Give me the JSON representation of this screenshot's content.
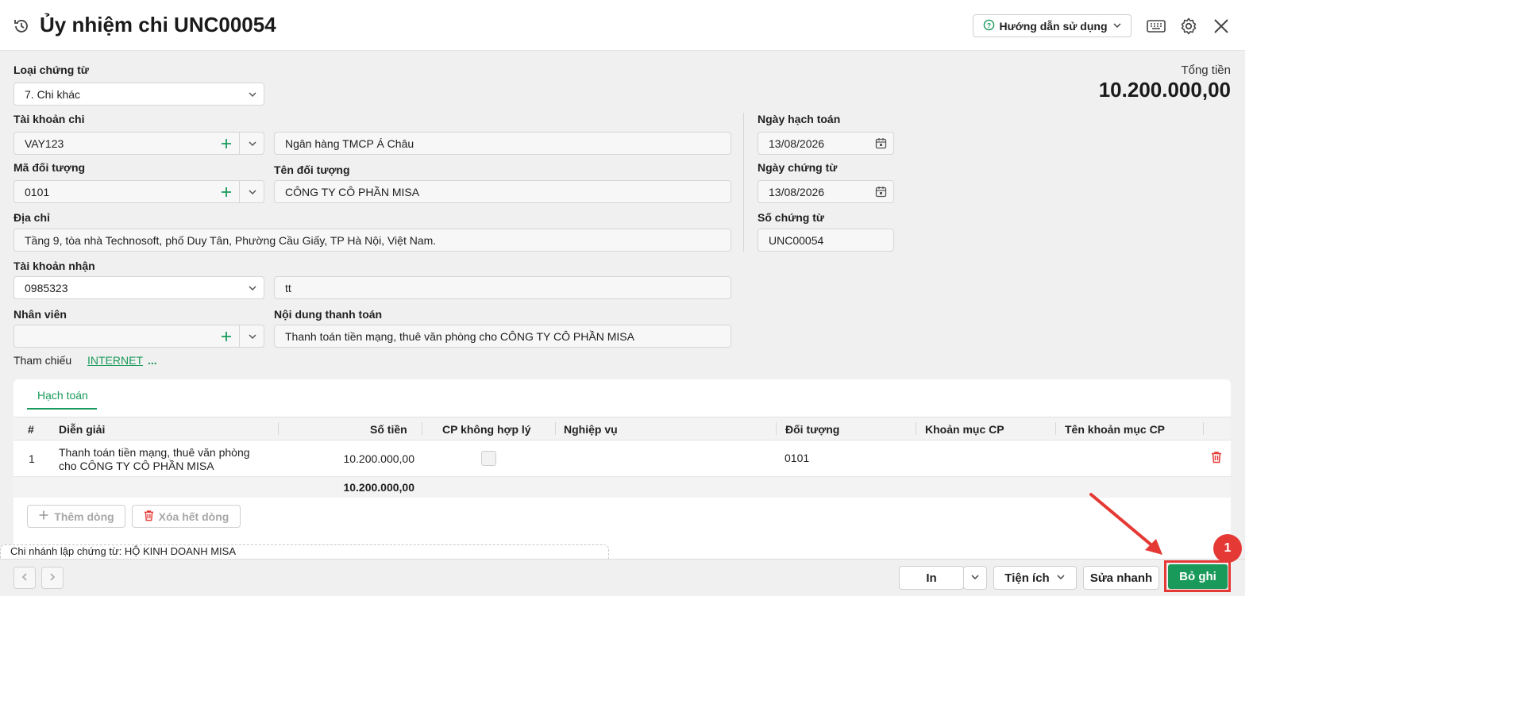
{
  "header": {
    "title": "Ủy nhiệm chi UNC00054",
    "help_label": "Hướng dẫn sử dụng"
  },
  "form": {
    "voucher_type": {
      "label": "Loại chứng từ",
      "value": "7. Chi khác"
    },
    "pay_account": {
      "label": "Tài khoản chi",
      "value": "VAY123",
      "bank_name": "Ngân hàng TMCP Á Châu"
    },
    "object_code": {
      "label": "Mã đối tượng",
      "value": "0101"
    },
    "object_name": {
      "label": "Tên đối tượng",
      "value": "CÔNG TY CÔ PHẦN MISA"
    },
    "address": {
      "label": "Địa chỉ",
      "value": "Tầng 9, tòa nhà Technosoft, phố Duy Tân, Phường Cầu Giấy, TP Hà Nội, Việt Nam."
    },
    "receive_account": {
      "label": "Tài khoản nhận",
      "value": "0985323",
      "bank_name": "tt"
    },
    "employee": {
      "label": "Nhân viên",
      "value": ""
    },
    "payment_content": {
      "label": "Nội dung thanh toán",
      "value": "Thanh toán tiền mạng, thuê văn phòng cho CÔNG TY CÔ PHẦN MISA"
    },
    "reference": {
      "label": "Tham chiếu",
      "link": "INTERNET",
      "more": "..."
    },
    "accounting_date": {
      "label": "Ngày hạch toán",
      "value": "13/08/2026"
    },
    "voucher_date": {
      "label": "Ngày chứng từ",
      "value": "13/08/2026"
    },
    "voucher_no": {
      "label": "Số chứng từ",
      "value": "UNC00054"
    }
  },
  "total": {
    "label": "Tổng tiền",
    "value": "10.200.000,00"
  },
  "grid": {
    "tab": "Hạch toán",
    "columns": [
      "#",
      "Diễn giải",
      "Số tiền",
      "CP không hợp lý",
      "Nghiệp vụ",
      "Đối tượng",
      "Khoản mục CP",
      "Tên khoản mục CP"
    ],
    "rows": [
      {
        "index": "1",
        "desc_line1": "Thanh toán tiền mạng, thuê văn phòng",
        "desc_line2": "cho CÔNG TY CÔ PHẦN MISA",
        "amount": "10.200.000,00",
        "object": "0101"
      }
    ],
    "sum": "10.200.000,00",
    "add_row": "Thêm dòng",
    "delete_all": "Xóa hết dòng"
  },
  "branch": "Chi nhánh lập chứng từ: HỘ KINH DOANH MISA",
  "footer": {
    "print": "In",
    "utilities": "Tiện ích",
    "quick_edit": "Sửa nhanh",
    "unpost": "Bỏ ghi",
    "badge": "1"
  },
  "colors": {
    "accent": "#1a9a5a",
    "highlight": "#e53935"
  }
}
